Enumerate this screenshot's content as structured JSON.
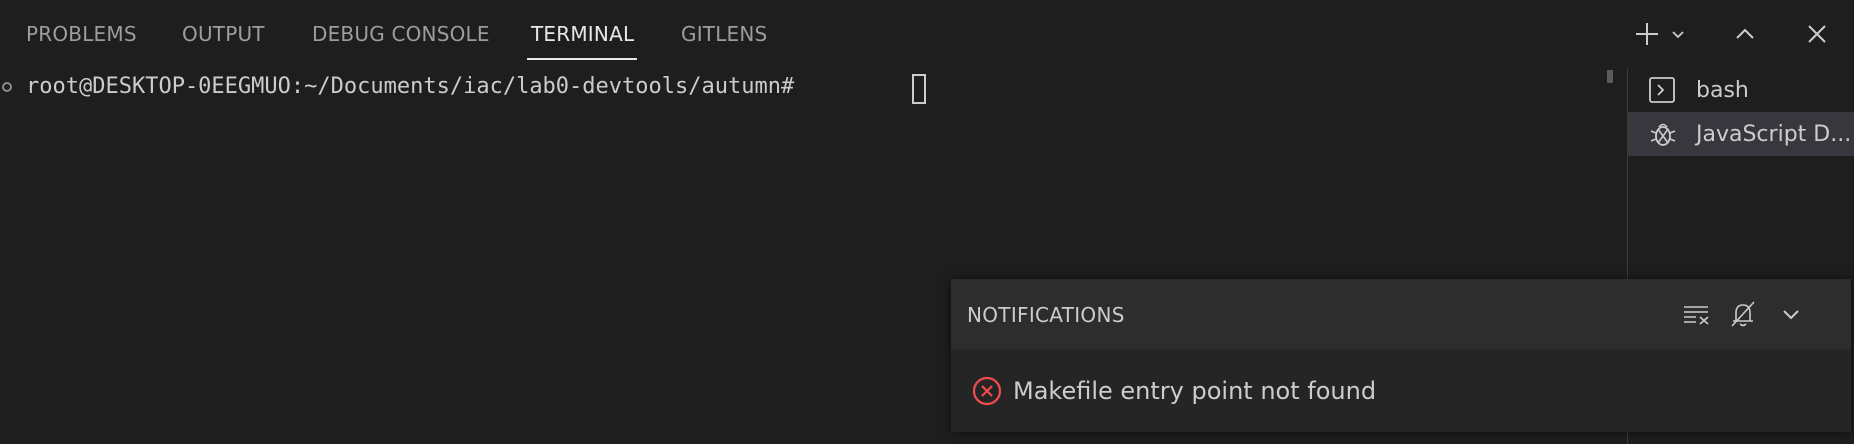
{
  "tabs": [
    {
      "label": "PROBLEMS"
    },
    {
      "label": "OUTPUT"
    },
    {
      "label": "DEBUG CONSOLE"
    },
    {
      "label": "TERMINAL",
      "active": true
    },
    {
      "label": "GITLENS"
    }
  ],
  "actions": {
    "new_terminal": "plus-icon",
    "launch_profile": "chevron-down-icon",
    "maximize": "chevron-up-icon",
    "close": "close-icon"
  },
  "terminal": {
    "prompt": "root@DESKTOP-0EEGMUO:~/Documents/iac/lab0-devtools/autumn# "
  },
  "terminal_list": [
    {
      "label": "bash",
      "icon": "terminal-icon",
      "selected": false
    },
    {
      "label": "JavaScript D...",
      "icon": "debug-icon",
      "selected": true
    }
  ],
  "notification": {
    "header": "NOTIFICATIONS",
    "message": "Makefile entry point not found",
    "severity_color": "#f14c4c"
  },
  "colors": {
    "background": "#1e1e1e",
    "selected_item": "#37373d",
    "error": "#f14c4c"
  }
}
